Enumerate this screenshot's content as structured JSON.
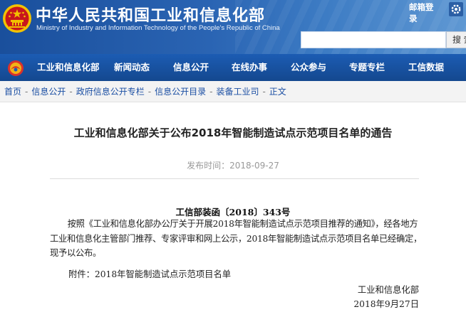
{
  "header": {
    "site_title": "中华人民共和国工业和信息化部",
    "site_subtitle": "Ministry of Industry and Information Technology of the People's Republic of China",
    "mail_login": "邮箱登录",
    "search_button": "搜 索",
    "search_placeholder": ""
  },
  "nav": {
    "items": [
      {
        "label": "工业和信息化部"
      },
      {
        "label": "新闻动态"
      },
      {
        "label": "信息公开"
      },
      {
        "label": "在线办事"
      },
      {
        "label": "公众参与"
      },
      {
        "label": "专题专栏"
      },
      {
        "label": "工信数据"
      }
    ]
  },
  "breadcrumb": {
    "items": [
      "首页",
      "信息公开",
      "政府信息公开专栏",
      "信息公开目录",
      "装备工业司",
      "正文"
    ],
    "separator": "-"
  },
  "article": {
    "title": "工业和信息化部关于公布2018年智能制造试点示范项目名单的通告",
    "publish_time": "发布时间：2018-09-27",
    "document_number": "工信部装函〔2018〕343号",
    "body": "按照《工业和信息化部办公厅关于开展2018年智能制造试点示范项目推荐的通知》，经各地方工业和信息化主管部门推荐、专家评审和网上公示，2018年智能制造试点示范项目名单已经确定，现予以公布。",
    "attachment": "附件：2018年智能制造试点示范项目名单",
    "signer": "工业和信息化部",
    "sign_date": "2018年9月27日"
  },
  "colors": {
    "header_blue": "#1a4f9c",
    "nav_blue": "#1c5cb3",
    "link_blue": "#1a4ea3",
    "emblem_red": "#c8161d",
    "emblem_gold": "#f2c200"
  },
  "icons": {
    "emblem": "national-emblem-icon",
    "nav_logo": "ministry-logo-icon",
    "settings": "settings-icon"
  }
}
